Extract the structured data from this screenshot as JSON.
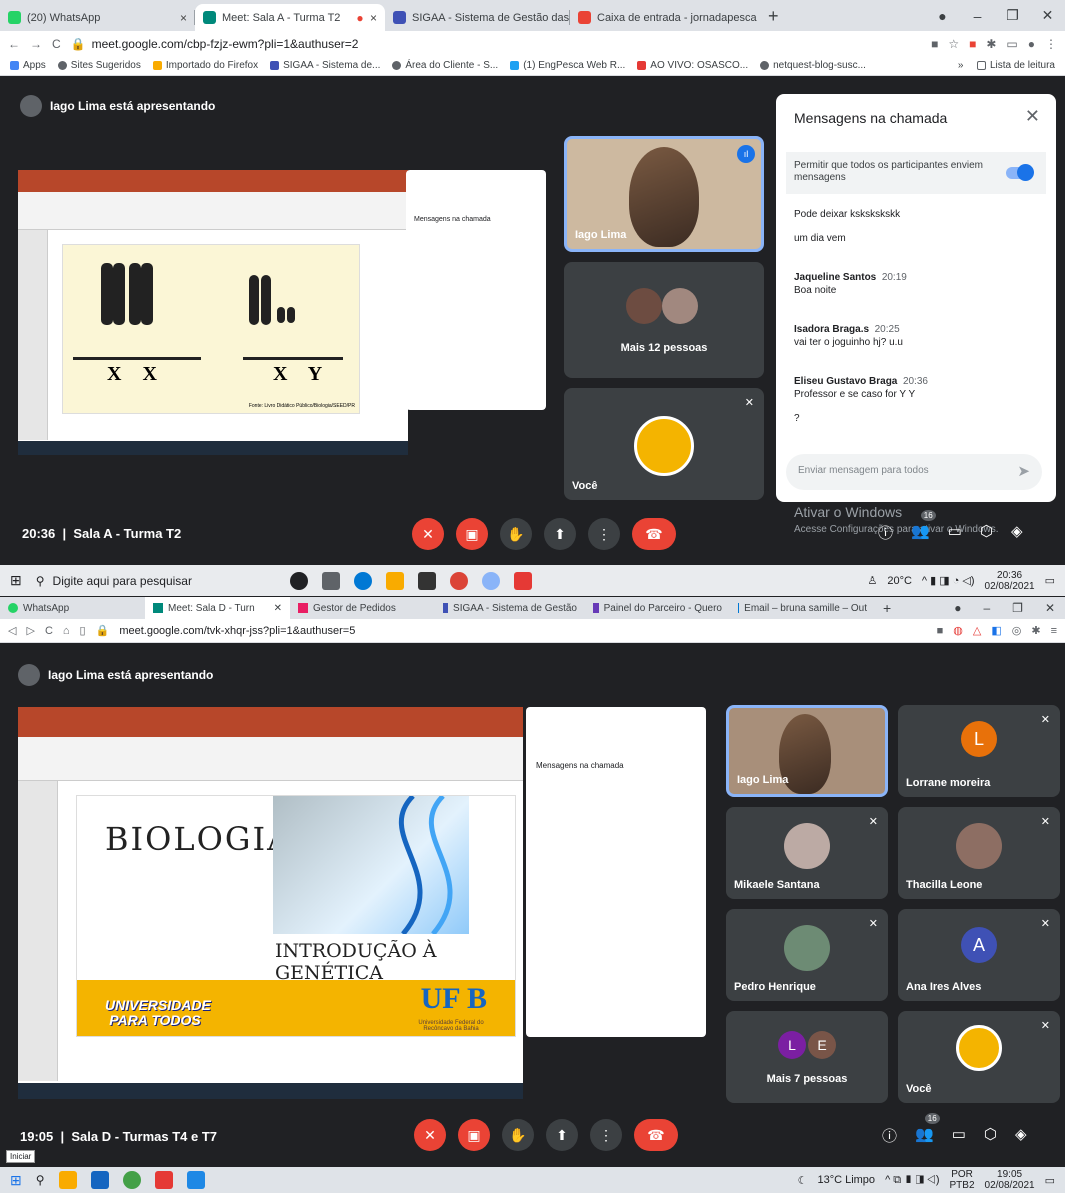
{
  "s1": {
    "tabs": [
      {
        "label": "(20) WhatsApp",
        "color": "#25d366",
        "active": false
      },
      {
        "label": "Meet: Sala A - Turma T2",
        "color": "#00897b",
        "active": true
      },
      {
        "label": "SIGAA - Sistema de Gestão das A",
        "color": "#3f51b5",
        "active": false
      },
      {
        "label": "Caixa de entrada - jornadapesca",
        "color": "#ea4335",
        "active": false
      }
    ],
    "url": "meet.google.com/cbp-fzjz-ewm?pli=1&authuser=2",
    "bookmarks": [
      "Apps",
      "Sites Sugeridos",
      "Importado do Firefox",
      "SIGAA - Sistema de...",
      "Área do Cliente - S...",
      "(1) EngPesca Web R...",
      "AO VIVO: OSASCO...",
      "netquest-blog-susc..."
    ],
    "reading_list": "Lista de leitura",
    "presenting": "Iago Lima está apresentando",
    "slide_labels": [
      "X X",
      "X Y"
    ],
    "slide_credit": "Fonte: Livro Didático Público/Biologia/SEED/PR",
    "tiles": [
      {
        "name": "Iago Lima"
      },
      {
        "name": "Mais 12 pessoas"
      },
      {
        "name": "Você"
      }
    ],
    "chat": {
      "title": "Mensagens na chamada",
      "toggle_label": "Permitir que todos os participantes enviem mensagens",
      "messages": [
        {
          "sender": "",
          "time": "",
          "text": "Pode deixar kskskskskk"
        },
        {
          "sender": "",
          "time": "",
          "text": "um dia vem"
        },
        {
          "sender": "Jaqueline Santos",
          "time": "20:19",
          "text": "Boa noite"
        },
        {
          "sender": "Isadora Braga.s",
          "time": "20:25",
          "text": "vai ter o joguinho hj? u.u"
        },
        {
          "sender": "Eliseu Gustavo Braga",
          "time": "20:36",
          "text": "Professor e se caso for Y Y"
        },
        {
          "sender": "",
          "time": "",
          "text": "?"
        }
      ],
      "placeholder": "Enviar mensagem para todos"
    },
    "time": "20:36",
    "room": "Sala A - Turma T2",
    "participants_count": "16",
    "watermark_1": "Ativar o Windows",
    "watermark_2": "Acesse Configurações para ativar o Windows.",
    "taskbar_search": "Digite aqui para pesquisar",
    "temperature": "20°C",
    "clock_time": "20:36",
    "clock_date": "02/08/2021"
  },
  "s2": {
    "tabs": [
      {
        "label": "WhatsApp",
        "color": "#25d366",
        "active": false
      },
      {
        "label": "Meet: Sala D - Turn",
        "color": "#00897b",
        "active": true
      },
      {
        "label": "Gestor de Pedidos",
        "color": "#e91e63",
        "active": false
      },
      {
        "label": "SIGAA - Sistema de Gestão",
        "color": "#3f51b5",
        "active": false
      },
      {
        "label": "Painel do Parceiro - Quero",
        "color": "#673ab7",
        "active": false
      },
      {
        "label": "Email – bruna samille – Out",
        "color": "#0078d4",
        "active": false
      }
    ],
    "url": "meet.google.com/tvk-xhqr-jss?pli=1&authuser=5",
    "presenting": "Iago Lima está apresentando",
    "slide_title": "BIOLOGIA",
    "slide_subtitle": "INTRODUÇÃO À GENÉTICA",
    "slide_logo": "UNIVERSIDADE PARA TODOS",
    "slide_uf": "UF B",
    "slide_uf_sub": "Universidade Federal do Recôncavo da Bahia",
    "tiles": [
      {
        "name": "Iago Lima",
        "letter": ""
      },
      {
        "name": "Lorrane moreira",
        "letter": "L"
      },
      {
        "name": "Mikaele Santana",
        "letter": ""
      },
      {
        "name": "Thacilla Leone",
        "letter": ""
      },
      {
        "name": "Pedro Henrique",
        "letter": ""
      },
      {
        "name": "Ana Ires Alves",
        "letter": "A"
      },
      {
        "name": "Mais 7 pessoas",
        "letter": ""
      },
      {
        "name": "Você",
        "letter": ""
      }
    ],
    "more_letters": [
      "L",
      "E"
    ],
    "time": "19:05",
    "room": "Sala D - Turmas T4 e T7",
    "participants_count": "16",
    "tooltip": "Iniciar",
    "weather": "13°C Limpo",
    "lang": "POR",
    "lang_sub": "PTB2",
    "clock_time": "19:05",
    "clock_date": "02/08/2021",
    "colors": {
      "lorrane": "#e8710a",
      "ana": "#3f51b5",
      "letter_l": "#7b1fa2",
      "letter_e": "#795548"
    }
  }
}
